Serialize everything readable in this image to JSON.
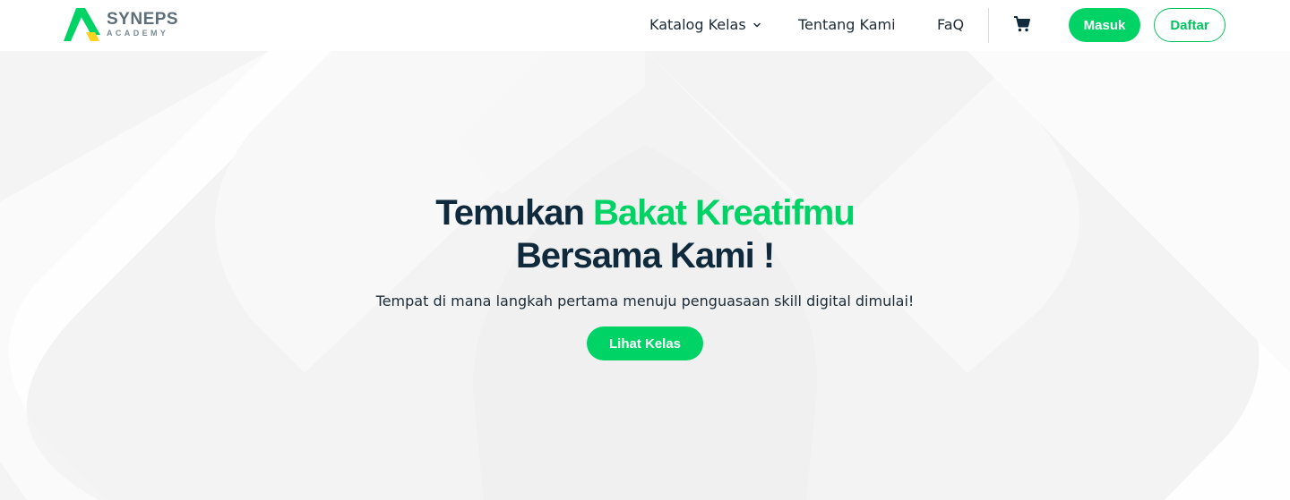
{
  "brand": {
    "name": "SYNEPS",
    "sub": "ACADEMY",
    "colors": {
      "green": "#00d365",
      "yellow": "#ffd21f",
      "navy": "#0f2a3d"
    }
  },
  "nav": {
    "katalog": "Katalog Kelas",
    "tentang": "Tentang Kami",
    "faq": "FaQ",
    "cart_icon": "cart-icon",
    "masuk": "Masuk",
    "daftar": "Daftar"
  },
  "hero": {
    "title_part1": "Temukan",
    "title_accent": "Bakat Kreatifmu",
    "title_line2": "Bersama Kami !",
    "subtitle": "Tempat di mana langkah pertama menuju penguasaan skill digital dimulai!",
    "cta": "Lihat Kelas"
  }
}
